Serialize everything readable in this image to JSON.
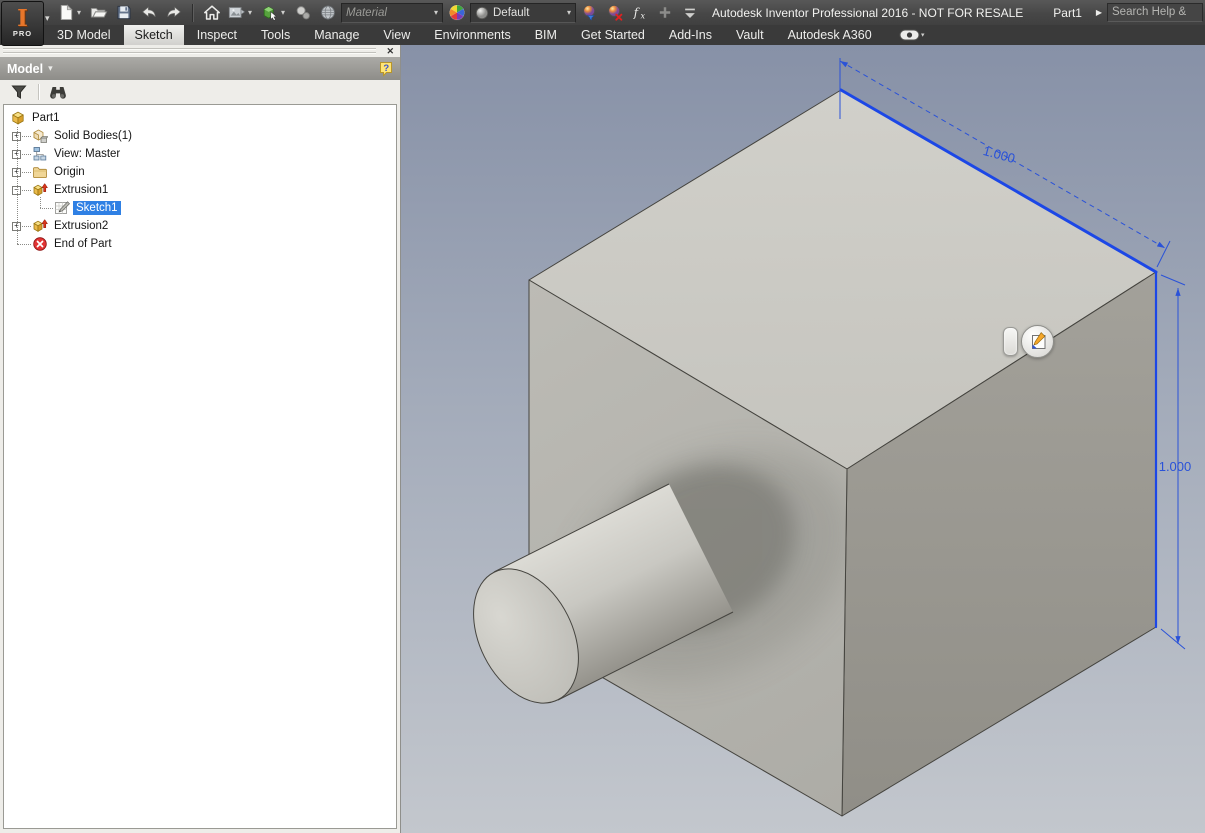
{
  "window": {
    "title": "Autodesk Inventor Professional 2016 - NOT FOR RESALE",
    "document_name": "Part1",
    "logo_label": "PRO"
  },
  "search": {
    "placeholder": "Search Help &"
  },
  "qat": {
    "items": [
      {
        "type": "icon",
        "name": "new-file-icon",
        "caret": true
      },
      {
        "type": "icon",
        "name": "open-folder-icon"
      },
      {
        "type": "icon",
        "name": "save-icon"
      },
      {
        "type": "icon",
        "name": "undo-icon"
      },
      {
        "type": "icon",
        "name": "redo-icon"
      },
      {
        "type": "separator"
      },
      {
        "type": "icon",
        "name": "home-icon"
      },
      {
        "type": "icon",
        "name": "image-icon",
        "caret": true
      },
      {
        "type": "icon",
        "name": "select-box-icon",
        "caret": true
      },
      {
        "type": "icon",
        "name": "spheres-icon"
      },
      {
        "type": "icon",
        "name": "appearance-globe-icon"
      },
      {
        "type": "combo",
        "name": "material-combo",
        "value": "Material",
        "muted": true,
        "width": 92
      },
      {
        "type": "icon",
        "name": "color-wheel-icon"
      },
      {
        "type": "combo",
        "name": "appearance-combo",
        "value": "Default",
        "icon": "sphere-icon",
        "width": 96
      },
      {
        "type": "icon",
        "name": "adjust-appearance-icon"
      },
      {
        "type": "icon",
        "name": "clear-appearance-icon"
      },
      {
        "type": "icon",
        "name": "parameters-fx-icon"
      },
      {
        "type": "icon",
        "name": "add-icon",
        "disabled": true
      },
      {
        "type": "icon",
        "name": "qat-customize-caret-icon"
      }
    ]
  },
  "ribbon": {
    "tabs": [
      {
        "label": "3D Model"
      },
      {
        "label": "Sketch",
        "active": true
      },
      {
        "label": "Inspect"
      },
      {
        "label": "Tools"
      },
      {
        "label": "Manage"
      },
      {
        "label": "View"
      },
      {
        "label": "Environments"
      },
      {
        "label": "BIM"
      },
      {
        "label": "Get Started"
      },
      {
        "label": "Add-Ins"
      },
      {
        "label": "Vault"
      },
      {
        "label": "Autodesk A360"
      }
    ],
    "status_icon": "a360-status-icon"
  },
  "browser": {
    "panel_title": "Model",
    "tools": [
      "filter-icon",
      "find-icon"
    ],
    "tree": [
      {
        "label": "Part1",
        "icon": "part-icon",
        "depth": 0
      },
      {
        "label": "Solid Bodies(1)",
        "icon": "solid-bodies-icon",
        "depth": 1,
        "expander": "plus"
      },
      {
        "label": "View: Master",
        "icon": "view-master-icon",
        "depth": 1,
        "expander": "plus"
      },
      {
        "label": "Origin",
        "icon": "folder-icon",
        "depth": 1,
        "expander": "plus"
      },
      {
        "label": "Extrusion1",
        "icon": "extrusion-icon",
        "depth": 1,
        "expander": "minus"
      },
      {
        "label": "Sketch1",
        "icon": "sketch-icon",
        "depth": 2,
        "selected": true
      },
      {
        "label": "Extrusion2",
        "icon": "extrusion-icon",
        "depth": 1,
        "expander": "plus"
      },
      {
        "label": "End of Part",
        "icon": "end-of-part-icon",
        "depth": 1
      }
    ]
  },
  "viewport": {
    "dimension_labels": [
      "1.000",
      "1.000"
    ],
    "mini_toolbar": {
      "button_icon": "edit-sketch-icon"
    }
  },
  "colors": {
    "selection_blue": "#2f80e4",
    "edge_highlight_blue": "#1c47e6",
    "dimension_blue": "#2a52d8"
  }
}
